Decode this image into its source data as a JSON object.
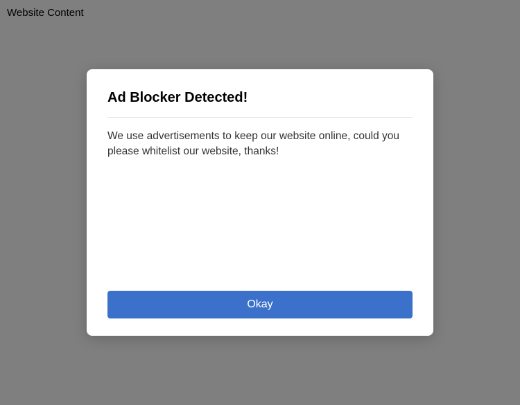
{
  "page": {
    "content_label": "Website Content"
  },
  "modal": {
    "title": "Ad Blocker Detected!",
    "message": "We use advertisements to keep our website online, could you please whitelist our website, thanks!",
    "okay_label": "Okay"
  },
  "colors": {
    "overlay": "rgba(0,0,0,0.5)",
    "primary_button": "#3b71ca"
  }
}
